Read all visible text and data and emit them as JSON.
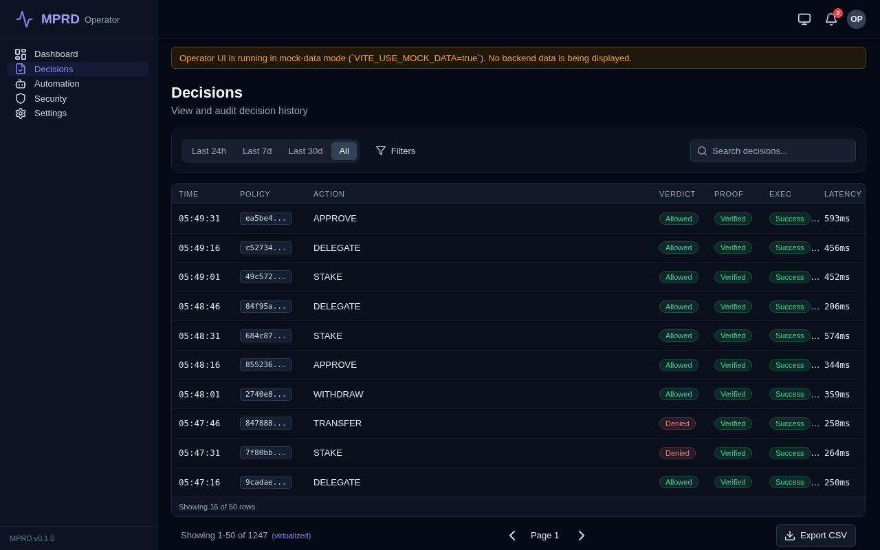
{
  "sidebar": {
    "brand": {
      "name": "MPRD",
      "subtitle": "Operator"
    },
    "items": [
      {
        "label": "Dashboard",
        "selected": false
      },
      {
        "label": "Decisions",
        "selected": true
      },
      {
        "label": "Automation",
        "selected": false
      },
      {
        "label": "Security",
        "selected": false
      },
      {
        "label": "Settings",
        "selected": false
      }
    ],
    "version": "MPRD v0.1.0"
  },
  "topbar": {
    "notifications": "2",
    "avatar": "OP"
  },
  "banner": "Operator UI is running in mock-data mode (`VITE_USE_MOCK_DATA=true`). No backend data is being displayed.",
  "page": {
    "title": "Decisions",
    "subtitle": "View and audit decision history"
  },
  "filters": {
    "ranges": [
      {
        "label": "Last 24h",
        "selected": false
      },
      {
        "label": "Last 7d",
        "selected": false
      },
      {
        "label": "Last 30d",
        "selected": false
      },
      {
        "label": "All",
        "selected": true
      }
    ],
    "filters_button": "Filters",
    "search": {
      "placeholder": "Search decisions..."
    }
  },
  "table": {
    "columns": [
      "TIME",
      "POLICY",
      "ACTION",
      "VERDICT",
      "PROOF",
      "EXEC",
      "LATENCY"
    ],
    "rows": [
      {
        "time": "05:49:31",
        "policy": "ea5be4...",
        "action": "APPROVE",
        "verdict": {
          "label": "Allowed",
          "color": "#34d399"
        },
        "proof": "Verified",
        "exec": "Success",
        "exec_overflow": "…",
        "latency": "593ms"
      },
      {
        "time": "05:49:16",
        "policy": "c52734...",
        "action": "DELEGATE",
        "verdict": {
          "label": "Allowed",
          "color": "#34d399"
        },
        "proof": "Verified",
        "exec": "Success",
        "exec_overflow": "…",
        "latency": "456ms"
      },
      {
        "time": "05:49:01",
        "policy": "49c572...",
        "action": "STAKE",
        "verdict": {
          "label": "Allowed",
          "color": "#34d399"
        },
        "proof": "Verified",
        "exec": "Success",
        "exec_overflow": "…",
        "latency": "452ms"
      },
      {
        "time": "05:48:46",
        "policy": "84f95a...",
        "action": "DELEGATE",
        "verdict": {
          "label": "Allowed",
          "color": "#34d399"
        },
        "proof": "Verified",
        "exec": "Success",
        "exec_overflow": "…",
        "latency": "206ms"
      },
      {
        "time": "05:48:31",
        "policy": "684c87...",
        "action": "STAKE",
        "verdict": {
          "label": "Allowed",
          "color": "#34d399"
        },
        "proof": "Verified",
        "exec": "Success",
        "exec_overflow": "…",
        "latency": "574ms"
      },
      {
        "time": "05:48:16",
        "policy": "855236...",
        "action": "APPROVE",
        "verdict": {
          "label": "Allowed",
          "color": "#34d399"
        },
        "proof": "Verified",
        "exec": "Success",
        "exec_overflow": "…",
        "latency": "344ms"
      },
      {
        "time": "05:48:01",
        "policy": "2740e8...",
        "action": "WITHDRAW",
        "verdict": {
          "label": "Allowed",
          "color": "#34d399"
        },
        "proof": "Verified",
        "exec": "Success",
        "exec_overflow": "…",
        "latency": "359ms"
      },
      {
        "time": "05:47:46",
        "policy": "847888...",
        "action": "TRANSFER",
        "verdict": {
          "label": "Denied",
          "color": "#f87171"
        },
        "proof": "Verified",
        "exec": "Success",
        "exec_overflow": "…",
        "latency": "258ms"
      },
      {
        "time": "05:47:31",
        "policy": "7f80bb...",
        "action": "STAKE",
        "verdict": {
          "label": "Denied",
          "color": "#f87171"
        },
        "proof": "Verified",
        "exec": "Success",
        "exec_overflow": "…",
        "latency": "264ms"
      },
      {
        "time": "05:47:16",
        "policy": "9cadae...",
        "action": "DELEGATE",
        "verdict": {
          "label": "Allowed",
          "color": "#34d399"
        },
        "proof": "Verified",
        "exec": "Success",
        "exec_overflow": "…",
        "latency": "250ms"
      }
    ],
    "footer": "Showing 16 of 50 rows"
  },
  "pagination": {
    "summary": "Showing 1-50 of 1247",
    "note": "(virtualized)",
    "page": "Page 1",
    "export": "Export CSV"
  }
}
